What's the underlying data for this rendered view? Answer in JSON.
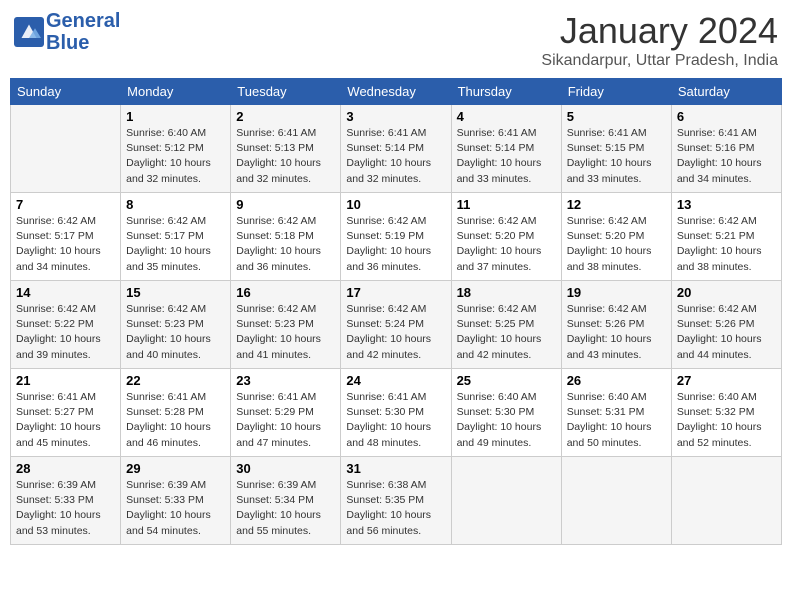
{
  "header": {
    "logo_line1": "General",
    "logo_line2": "Blue",
    "month_year": "January 2024",
    "location": "Sikandarpur, Uttar Pradesh, India"
  },
  "days_of_week": [
    "Sunday",
    "Monday",
    "Tuesday",
    "Wednesday",
    "Thursday",
    "Friday",
    "Saturday"
  ],
  "weeks": [
    [
      {
        "day": "",
        "info": ""
      },
      {
        "day": "1",
        "info": "Sunrise: 6:40 AM\nSunset: 5:12 PM\nDaylight: 10 hours\nand 32 minutes."
      },
      {
        "day": "2",
        "info": "Sunrise: 6:41 AM\nSunset: 5:13 PM\nDaylight: 10 hours\nand 32 minutes."
      },
      {
        "day": "3",
        "info": "Sunrise: 6:41 AM\nSunset: 5:14 PM\nDaylight: 10 hours\nand 32 minutes."
      },
      {
        "day": "4",
        "info": "Sunrise: 6:41 AM\nSunset: 5:14 PM\nDaylight: 10 hours\nand 33 minutes."
      },
      {
        "day": "5",
        "info": "Sunrise: 6:41 AM\nSunset: 5:15 PM\nDaylight: 10 hours\nand 33 minutes."
      },
      {
        "day": "6",
        "info": "Sunrise: 6:41 AM\nSunset: 5:16 PM\nDaylight: 10 hours\nand 34 minutes."
      }
    ],
    [
      {
        "day": "7",
        "info": "Sunrise: 6:42 AM\nSunset: 5:17 PM\nDaylight: 10 hours\nand 34 minutes."
      },
      {
        "day": "8",
        "info": "Sunrise: 6:42 AM\nSunset: 5:17 PM\nDaylight: 10 hours\nand 35 minutes."
      },
      {
        "day": "9",
        "info": "Sunrise: 6:42 AM\nSunset: 5:18 PM\nDaylight: 10 hours\nand 36 minutes."
      },
      {
        "day": "10",
        "info": "Sunrise: 6:42 AM\nSunset: 5:19 PM\nDaylight: 10 hours\nand 36 minutes."
      },
      {
        "day": "11",
        "info": "Sunrise: 6:42 AM\nSunset: 5:20 PM\nDaylight: 10 hours\nand 37 minutes."
      },
      {
        "day": "12",
        "info": "Sunrise: 6:42 AM\nSunset: 5:20 PM\nDaylight: 10 hours\nand 38 minutes."
      },
      {
        "day": "13",
        "info": "Sunrise: 6:42 AM\nSunset: 5:21 PM\nDaylight: 10 hours\nand 38 minutes."
      }
    ],
    [
      {
        "day": "14",
        "info": "Sunrise: 6:42 AM\nSunset: 5:22 PM\nDaylight: 10 hours\nand 39 minutes."
      },
      {
        "day": "15",
        "info": "Sunrise: 6:42 AM\nSunset: 5:23 PM\nDaylight: 10 hours\nand 40 minutes."
      },
      {
        "day": "16",
        "info": "Sunrise: 6:42 AM\nSunset: 5:23 PM\nDaylight: 10 hours\nand 41 minutes."
      },
      {
        "day": "17",
        "info": "Sunrise: 6:42 AM\nSunset: 5:24 PM\nDaylight: 10 hours\nand 42 minutes."
      },
      {
        "day": "18",
        "info": "Sunrise: 6:42 AM\nSunset: 5:25 PM\nDaylight: 10 hours\nand 42 minutes."
      },
      {
        "day": "19",
        "info": "Sunrise: 6:42 AM\nSunset: 5:26 PM\nDaylight: 10 hours\nand 43 minutes."
      },
      {
        "day": "20",
        "info": "Sunrise: 6:42 AM\nSunset: 5:26 PM\nDaylight: 10 hours\nand 44 minutes."
      }
    ],
    [
      {
        "day": "21",
        "info": "Sunrise: 6:41 AM\nSunset: 5:27 PM\nDaylight: 10 hours\nand 45 minutes."
      },
      {
        "day": "22",
        "info": "Sunrise: 6:41 AM\nSunset: 5:28 PM\nDaylight: 10 hours\nand 46 minutes."
      },
      {
        "day": "23",
        "info": "Sunrise: 6:41 AM\nSunset: 5:29 PM\nDaylight: 10 hours\nand 47 minutes."
      },
      {
        "day": "24",
        "info": "Sunrise: 6:41 AM\nSunset: 5:30 PM\nDaylight: 10 hours\nand 48 minutes."
      },
      {
        "day": "25",
        "info": "Sunrise: 6:40 AM\nSunset: 5:30 PM\nDaylight: 10 hours\nand 49 minutes."
      },
      {
        "day": "26",
        "info": "Sunrise: 6:40 AM\nSunset: 5:31 PM\nDaylight: 10 hours\nand 50 minutes."
      },
      {
        "day": "27",
        "info": "Sunrise: 6:40 AM\nSunset: 5:32 PM\nDaylight: 10 hours\nand 52 minutes."
      }
    ],
    [
      {
        "day": "28",
        "info": "Sunrise: 6:39 AM\nSunset: 5:33 PM\nDaylight: 10 hours\nand 53 minutes."
      },
      {
        "day": "29",
        "info": "Sunrise: 6:39 AM\nSunset: 5:33 PM\nDaylight: 10 hours\nand 54 minutes."
      },
      {
        "day": "30",
        "info": "Sunrise: 6:39 AM\nSunset: 5:34 PM\nDaylight: 10 hours\nand 55 minutes."
      },
      {
        "day": "31",
        "info": "Sunrise: 6:38 AM\nSunset: 5:35 PM\nDaylight: 10 hours\nand 56 minutes."
      },
      {
        "day": "",
        "info": ""
      },
      {
        "day": "",
        "info": ""
      },
      {
        "day": "",
        "info": ""
      }
    ]
  ]
}
